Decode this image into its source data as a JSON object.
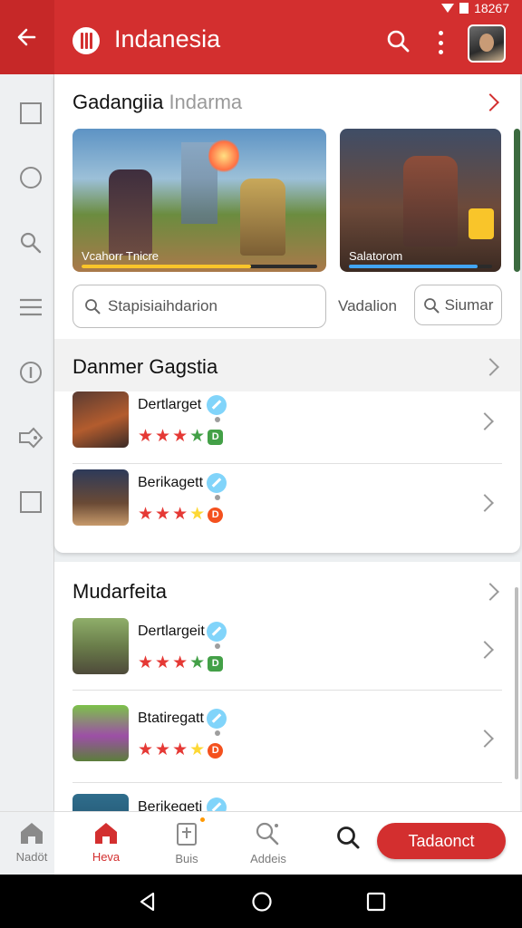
{
  "status": {
    "time": "18267"
  },
  "header": {
    "title": "Indanesia",
    "back_icon": "arrow-left-icon",
    "search_icon": "search-icon",
    "more_icon": "more-vert-icon"
  },
  "rail": {
    "icons": [
      "square-icon",
      "circle-icon",
      "search-icon",
      "menu-icon",
      "info-icon",
      "tag-icon",
      "square-icon"
    ]
  },
  "featured": {
    "title_main": "Gadangiia",
    "title_muted": "Indarma",
    "banners": [
      {
        "label": "Vcahorr Tnicre",
        "progress": 0.72,
        "bar_color": "#f9c52a"
      },
      {
        "label": "Salatorom",
        "progress": 0.9,
        "bar_color": "#42a5f5"
      }
    ],
    "search_placeholder": "Stapisiaihdarion",
    "filter_label": "Vadalion",
    "simar_label": "Siumar"
  },
  "section_danmer": {
    "title": "Danmer Gagstia",
    "apps": [
      {
        "name": "Dertlarget",
        "stars": [
          "r",
          "r",
          "r",
          "g"
        ],
        "badge": "D",
        "badge_color": "#43a047"
      },
      {
        "name": "Berikagett",
        "stars": [
          "r",
          "r",
          "r",
          "y"
        ],
        "badge": "D",
        "badge_color": "#f4511e"
      }
    ]
  },
  "section_mudarfeita": {
    "title": "Mudarfeita",
    "apps": [
      {
        "name": "Dertlargeit",
        "stars": [
          "r",
          "r",
          "r",
          "g"
        ],
        "badge": "D",
        "badge_color": "#43a047"
      },
      {
        "name": "Btatiregatt",
        "stars": [
          "r",
          "r",
          "r",
          "y"
        ],
        "badge": "D",
        "badge_color": "#f4511e"
      },
      {
        "name": "Berikegeti"
      }
    ]
  },
  "bottom_nav": {
    "items": [
      {
        "label": "Nadöt",
        "icon": "home-icon"
      },
      {
        "label": "Heva",
        "icon": "home-icon"
      },
      {
        "label": "Buis",
        "icon": "clipboard-icon"
      },
      {
        "label": "Addeis",
        "icon": "search-person-icon"
      }
    ],
    "search_icon": "search-icon",
    "cta_label": "Tadaonct"
  }
}
